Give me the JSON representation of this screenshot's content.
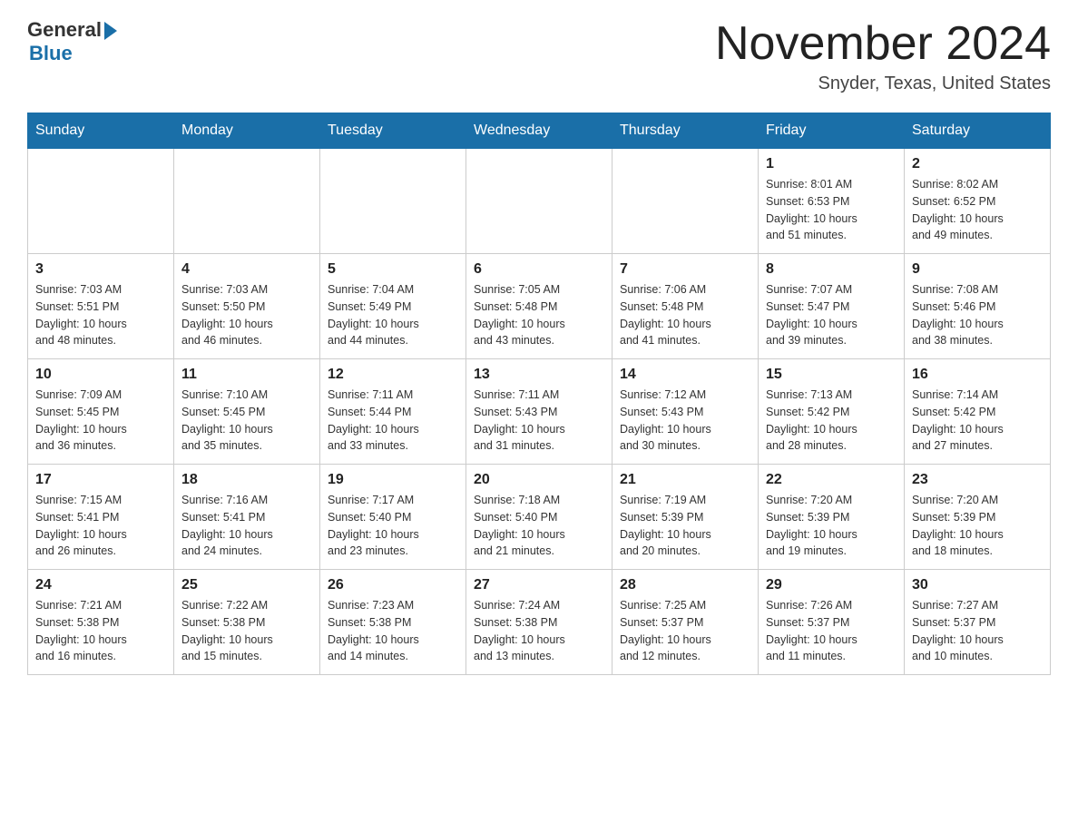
{
  "logo": {
    "general_text": "General",
    "blue_text": "Blue"
  },
  "title": {
    "month_year": "November 2024",
    "location": "Snyder, Texas, United States"
  },
  "weekdays": [
    "Sunday",
    "Monday",
    "Tuesday",
    "Wednesday",
    "Thursday",
    "Friday",
    "Saturday"
  ],
  "weeks": [
    [
      {
        "day": "",
        "info": ""
      },
      {
        "day": "",
        "info": ""
      },
      {
        "day": "",
        "info": ""
      },
      {
        "day": "",
        "info": ""
      },
      {
        "day": "",
        "info": ""
      },
      {
        "day": "1",
        "info": "Sunrise: 8:01 AM\nSunset: 6:53 PM\nDaylight: 10 hours\nand 51 minutes."
      },
      {
        "day": "2",
        "info": "Sunrise: 8:02 AM\nSunset: 6:52 PM\nDaylight: 10 hours\nand 49 minutes."
      }
    ],
    [
      {
        "day": "3",
        "info": "Sunrise: 7:03 AM\nSunset: 5:51 PM\nDaylight: 10 hours\nand 48 minutes."
      },
      {
        "day": "4",
        "info": "Sunrise: 7:03 AM\nSunset: 5:50 PM\nDaylight: 10 hours\nand 46 minutes."
      },
      {
        "day": "5",
        "info": "Sunrise: 7:04 AM\nSunset: 5:49 PM\nDaylight: 10 hours\nand 44 minutes."
      },
      {
        "day": "6",
        "info": "Sunrise: 7:05 AM\nSunset: 5:48 PM\nDaylight: 10 hours\nand 43 minutes."
      },
      {
        "day": "7",
        "info": "Sunrise: 7:06 AM\nSunset: 5:48 PM\nDaylight: 10 hours\nand 41 minutes."
      },
      {
        "day": "8",
        "info": "Sunrise: 7:07 AM\nSunset: 5:47 PM\nDaylight: 10 hours\nand 39 minutes."
      },
      {
        "day": "9",
        "info": "Sunrise: 7:08 AM\nSunset: 5:46 PM\nDaylight: 10 hours\nand 38 minutes."
      }
    ],
    [
      {
        "day": "10",
        "info": "Sunrise: 7:09 AM\nSunset: 5:45 PM\nDaylight: 10 hours\nand 36 minutes."
      },
      {
        "day": "11",
        "info": "Sunrise: 7:10 AM\nSunset: 5:45 PM\nDaylight: 10 hours\nand 35 minutes."
      },
      {
        "day": "12",
        "info": "Sunrise: 7:11 AM\nSunset: 5:44 PM\nDaylight: 10 hours\nand 33 minutes."
      },
      {
        "day": "13",
        "info": "Sunrise: 7:11 AM\nSunset: 5:43 PM\nDaylight: 10 hours\nand 31 minutes."
      },
      {
        "day": "14",
        "info": "Sunrise: 7:12 AM\nSunset: 5:43 PM\nDaylight: 10 hours\nand 30 minutes."
      },
      {
        "day": "15",
        "info": "Sunrise: 7:13 AM\nSunset: 5:42 PM\nDaylight: 10 hours\nand 28 minutes."
      },
      {
        "day": "16",
        "info": "Sunrise: 7:14 AM\nSunset: 5:42 PM\nDaylight: 10 hours\nand 27 minutes."
      }
    ],
    [
      {
        "day": "17",
        "info": "Sunrise: 7:15 AM\nSunset: 5:41 PM\nDaylight: 10 hours\nand 26 minutes."
      },
      {
        "day": "18",
        "info": "Sunrise: 7:16 AM\nSunset: 5:41 PM\nDaylight: 10 hours\nand 24 minutes."
      },
      {
        "day": "19",
        "info": "Sunrise: 7:17 AM\nSunset: 5:40 PM\nDaylight: 10 hours\nand 23 minutes."
      },
      {
        "day": "20",
        "info": "Sunrise: 7:18 AM\nSunset: 5:40 PM\nDaylight: 10 hours\nand 21 minutes."
      },
      {
        "day": "21",
        "info": "Sunrise: 7:19 AM\nSunset: 5:39 PM\nDaylight: 10 hours\nand 20 minutes."
      },
      {
        "day": "22",
        "info": "Sunrise: 7:20 AM\nSunset: 5:39 PM\nDaylight: 10 hours\nand 19 minutes."
      },
      {
        "day": "23",
        "info": "Sunrise: 7:20 AM\nSunset: 5:39 PM\nDaylight: 10 hours\nand 18 minutes."
      }
    ],
    [
      {
        "day": "24",
        "info": "Sunrise: 7:21 AM\nSunset: 5:38 PM\nDaylight: 10 hours\nand 16 minutes."
      },
      {
        "day": "25",
        "info": "Sunrise: 7:22 AM\nSunset: 5:38 PM\nDaylight: 10 hours\nand 15 minutes."
      },
      {
        "day": "26",
        "info": "Sunrise: 7:23 AM\nSunset: 5:38 PM\nDaylight: 10 hours\nand 14 minutes."
      },
      {
        "day": "27",
        "info": "Sunrise: 7:24 AM\nSunset: 5:38 PM\nDaylight: 10 hours\nand 13 minutes."
      },
      {
        "day": "28",
        "info": "Sunrise: 7:25 AM\nSunset: 5:37 PM\nDaylight: 10 hours\nand 12 minutes."
      },
      {
        "day": "29",
        "info": "Sunrise: 7:26 AM\nSunset: 5:37 PM\nDaylight: 10 hours\nand 11 minutes."
      },
      {
        "day": "30",
        "info": "Sunrise: 7:27 AM\nSunset: 5:37 PM\nDaylight: 10 hours\nand 10 minutes."
      }
    ]
  ]
}
